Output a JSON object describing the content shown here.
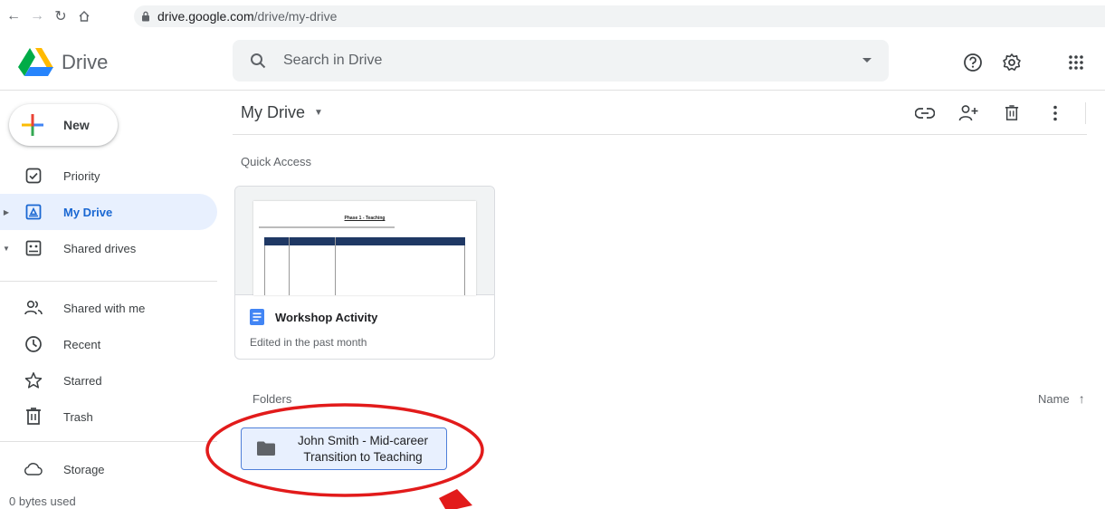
{
  "browser": {
    "url_host": "drive.google.com",
    "url_path": "/drive/my-drive"
  },
  "header": {
    "brand": "Drive",
    "search_placeholder": "Search in Drive"
  },
  "sidebar": {
    "new_label": "New",
    "items": [
      {
        "label": "Priority",
        "icon": "priority-check-icon"
      },
      {
        "label": "My Drive",
        "icon": "my-drive-icon",
        "active": true
      },
      {
        "label": "Shared drives",
        "icon": "shared-drives-icon"
      },
      {
        "label": "Shared with me",
        "icon": "shared-with-me-icon"
      },
      {
        "label": "Recent",
        "icon": "clock-icon"
      },
      {
        "label": "Starred",
        "icon": "star-icon"
      },
      {
        "label": "Trash",
        "icon": "trash-icon"
      },
      {
        "label": "Storage",
        "icon": "cloud-icon"
      }
    ],
    "storage_used": "0 bytes used"
  },
  "main": {
    "title": "My Drive",
    "quick_access_title": "Quick Access",
    "quick_access": [
      {
        "name": "Workshop Activity",
        "subtitle": "Edited in the past month",
        "thumb_heading": "Phase 1 - Teaching"
      }
    ],
    "folders_title": "Folders",
    "sort_label": "Name",
    "folders": [
      {
        "name": "John Smith - Mid-career Transition to Teaching"
      }
    ]
  },
  "colors": {
    "accent": "#1967d2",
    "active_bg": "#e8f0fe",
    "annotation": "#e21b1b"
  }
}
